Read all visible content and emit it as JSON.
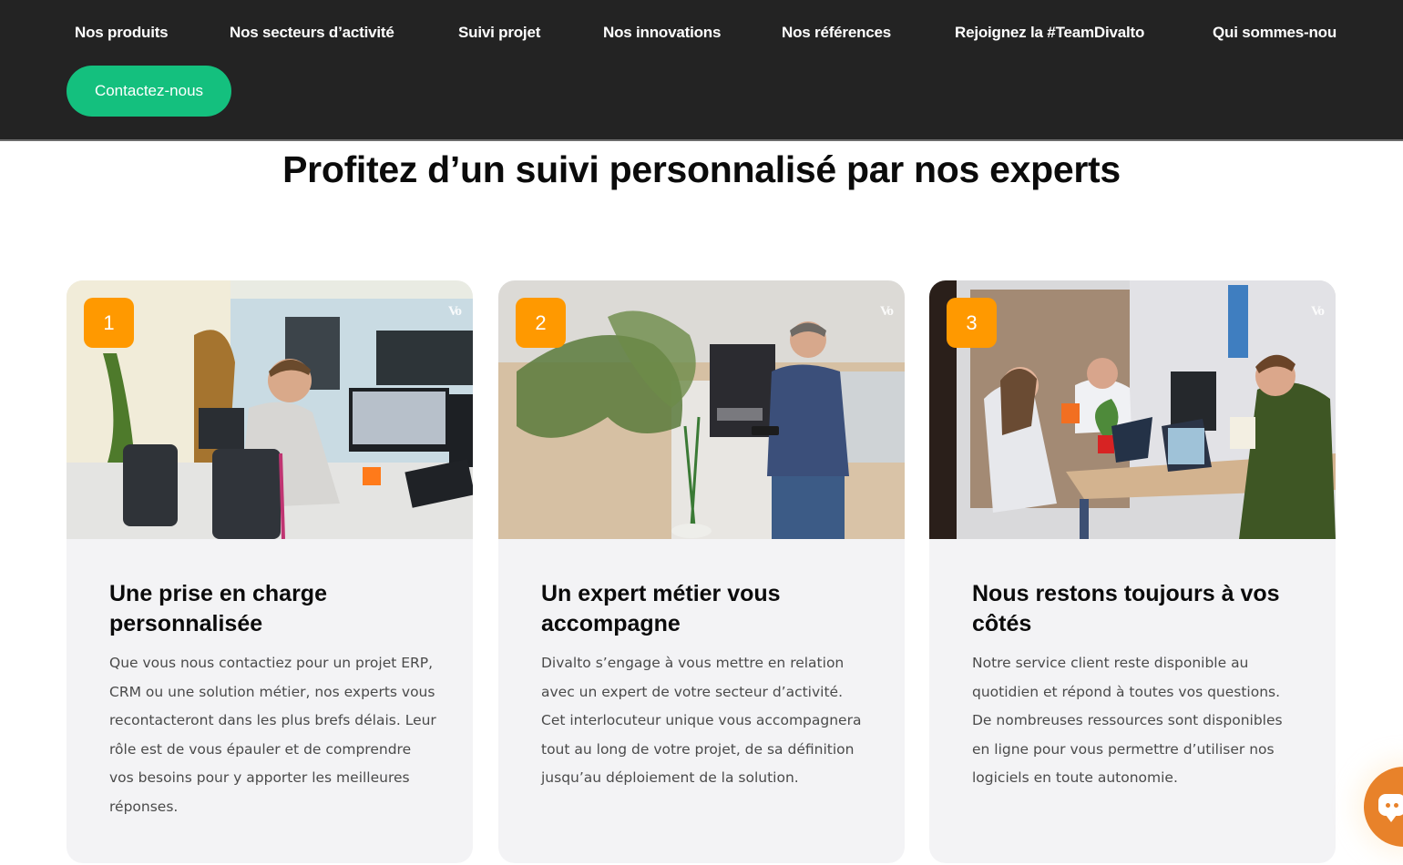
{
  "nav": {
    "items": [
      {
        "label": "Nos produits"
      },
      {
        "label": "Nos secteurs d’activité"
      },
      {
        "label": "Suivi projet"
      },
      {
        "label": "Nos innovations"
      },
      {
        "label": "Nos références"
      },
      {
        "label": "Rejoignez la #TeamDivalto"
      },
      {
        "label": "Qui sommes-nous"
      }
    ],
    "contact_label": "Contactez-nous"
  },
  "colors": {
    "header_bg": "#232323",
    "accent_green": "#14c07e",
    "badge_orange": "#ff9900",
    "chat_orange": "#e8822a",
    "card_bg": "#f3f3f5"
  },
  "section": {
    "title": "Profitez d’un suivi personnalisé par nos experts"
  },
  "cards": [
    {
      "number": "1",
      "watermark": "Vo",
      "image_alt": "Employee working at desk with monitors",
      "title": "Une prise en charge personnalisée",
      "text": "Que vous nous contactiez pour un projet ERP, CRM ou une solution métier, nos experts vous recontacteront dans les plus brefs délais. Leur rôle est de vous épauler et de comprendre vos besoins pour y apporter les meilleures réponses."
    },
    {
      "number": "2",
      "watermark": "Vo",
      "image_alt": "Expert with headset holding a tablet next to an ERP | CRM poster",
      "title": "Un expert métier vous accompagne",
      "text": "Divalto s’engage à vous mettre en relation avec un expert de votre secteur d’activité. Cet interlocuteur unique vous accompagnera tout au long de votre projet, de sa définition jusqu’au déploiement de la solution."
    },
    {
      "number": "3",
      "watermark": "Vo",
      "image_alt": "Three colleagues meeting around a desk with laptops",
      "title": "Nous restons toujours à vos côtés",
      "text": "Notre service client reste disponible au quotidien et répond à toutes vos questions. De nombreuses ressources sont disponibles en ligne pour vous permettre d’utiliser nos logiciels en toute autonomie."
    }
  ],
  "chat": {
    "icon": "chat-bubble-icon"
  }
}
